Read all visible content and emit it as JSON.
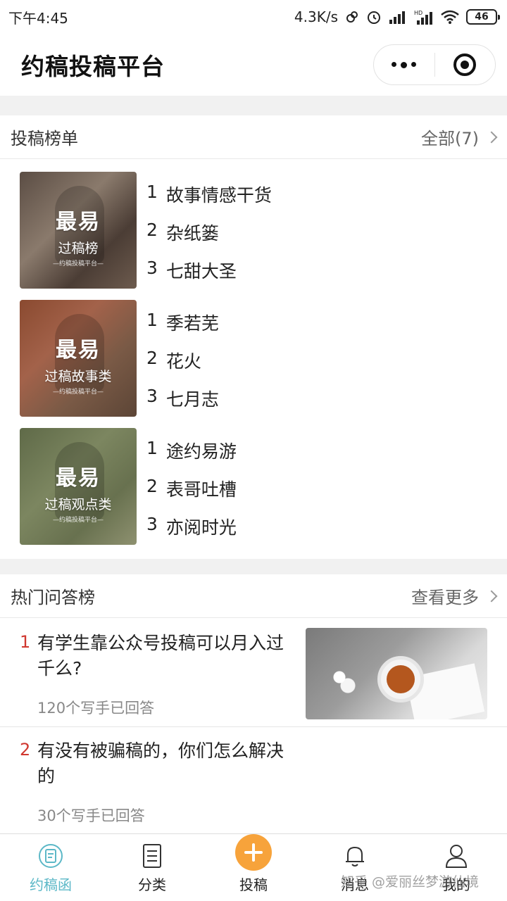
{
  "status_bar": {
    "time": "下午4:45",
    "network_speed": "4.3K/s",
    "battery": "46"
  },
  "header": {
    "title": "约稿投稿平台"
  },
  "ranking": {
    "title": "投稿榜单",
    "more": "全部(7)",
    "boards": [
      {
        "cover_title": "最易",
        "cover_subtitle": "过稿榜",
        "cover_small": "—约稿投稿平台—",
        "items": [
          {
            "rank": "1",
            "name": "故事情感干货"
          },
          {
            "rank": "2",
            "name": "杂纸篓"
          },
          {
            "rank": "3",
            "name": "七甜大圣"
          }
        ]
      },
      {
        "cover_title": "最易",
        "cover_subtitle": "过稿故事类",
        "cover_small": "—约稿投稿平台—",
        "items": [
          {
            "rank": "1",
            "name": "季若芜"
          },
          {
            "rank": "2",
            "name": "花火"
          },
          {
            "rank": "3",
            "name": "七月志"
          }
        ]
      },
      {
        "cover_title": "最易",
        "cover_subtitle": "过稿观点类",
        "cover_small": "—约稿投稿平台—",
        "items": [
          {
            "rank": "1",
            "name": "途约易游"
          },
          {
            "rank": "2",
            "name": "表哥吐槽"
          },
          {
            "rank": "3",
            "name": "亦阅时光"
          }
        ]
      }
    ]
  },
  "qa": {
    "title": "热门问答榜",
    "more": "查看更多",
    "items": [
      {
        "rank": "1",
        "question": "有学生靠公众号投稿可以月入过千么?",
        "answers": "120个写手已回答"
      },
      {
        "rank": "2",
        "question": "有没有被骗稿的，你们怎么解决的",
        "answers": "30个写手已回答"
      }
    ]
  },
  "tabs": [
    {
      "label": "约稿函",
      "icon": "letter-icon",
      "active": true
    },
    {
      "label": "分类",
      "icon": "list-icon",
      "active": false
    },
    {
      "label": "投稿",
      "icon": "plus-icon",
      "active": false
    },
    {
      "label": "消息",
      "icon": "bell-icon",
      "active": false
    },
    {
      "label": "我的",
      "icon": "user-icon",
      "active": false
    }
  ],
  "watermark": "知乎 @爱丽丝梦游仙境",
  "colors": {
    "accent": "#f7a33b",
    "active_tab": "#5cb8c7",
    "rank_red": "#d0372f"
  }
}
